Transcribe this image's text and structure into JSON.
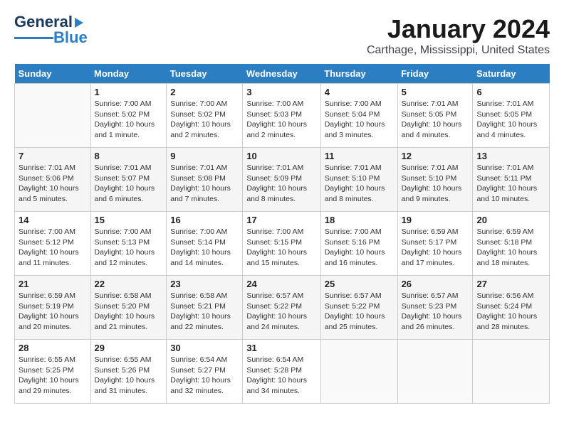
{
  "header": {
    "logo_line1": "General",
    "logo_line2": "Blue",
    "month": "January 2024",
    "location": "Carthage, Mississippi, United States"
  },
  "weekdays": [
    "Sunday",
    "Monday",
    "Tuesday",
    "Wednesday",
    "Thursday",
    "Friday",
    "Saturday"
  ],
  "weeks": [
    [
      {
        "day": "",
        "info": ""
      },
      {
        "day": "1",
        "info": "Sunrise: 7:00 AM\nSunset: 5:02 PM\nDaylight: 10 hours\nand 1 minute."
      },
      {
        "day": "2",
        "info": "Sunrise: 7:00 AM\nSunset: 5:02 PM\nDaylight: 10 hours\nand 2 minutes."
      },
      {
        "day": "3",
        "info": "Sunrise: 7:00 AM\nSunset: 5:03 PM\nDaylight: 10 hours\nand 2 minutes."
      },
      {
        "day": "4",
        "info": "Sunrise: 7:00 AM\nSunset: 5:04 PM\nDaylight: 10 hours\nand 3 minutes."
      },
      {
        "day": "5",
        "info": "Sunrise: 7:01 AM\nSunset: 5:05 PM\nDaylight: 10 hours\nand 4 minutes."
      },
      {
        "day": "6",
        "info": "Sunrise: 7:01 AM\nSunset: 5:05 PM\nDaylight: 10 hours\nand 4 minutes."
      }
    ],
    [
      {
        "day": "7",
        "info": "Sunrise: 7:01 AM\nSunset: 5:06 PM\nDaylight: 10 hours\nand 5 minutes."
      },
      {
        "day": "8",
        "info": "Sunrise: 7:01 AM\nSunset: 5:07 PM\nDaylight: 10 hours\nand 6 minutes."
      },
      {
        "day": "9",
        "info": "Sunrise: 7:01 AM\nSunset: 5:08 PM\nDaylight: 10 hours\nand 7 minutes."
      },
      {
        "day": "10",
        "info": "Sunrise: 7:01 AM\nSunset: 5:09 PM\nDaylight: 10 hours\nand 8 minutes."
      },
      {
        "day": "11",
        "info": "Sunrise: 7:01 AM\nSunset: 5:10 PM\nDaylight: 10 hours\nand 8 minutes."
      },
      {
        "day": "12",
        "info": "Sunrise: 7:01 AM\nSunset: 5:10 PM\nDaylight: 10 hours\nand 9 minutes."
      },
      {
        "day": "13",
        "info": "Sunrise: 7:01 AM\nSunset: 5:11 PM\nDaylight: 10 hours\nand 10 minutes."
      }
    ],
    [
      {
        "day": "14",
        "info": "Sunrise: 7:00 AM\nSunset: 5:12 PM\nDaylight: 10 hours\nand 11 minutes."
      },
      {
        "day": "15",
        "info": "Sunrise: 7:00 AM\nSunset: 5:13 PM\nDaylight: 10 hours\nand 12 minutes."
      },
      {
        "day": "16",
        "info": "Sunrise: 7:00 AM\nSunset: 5:14 PM\nDaylight: 10 hours\nand 14 minutes."
      },
      {
        "day": "17",
        "info": "Sunrise: 7:00 AM\nSunset: 5:15 PM\nDaylight: 10 hours\nand 15 minutes."
      },
      {
        "day": "18",
        "info": "Sunrise: 7:00 AM\nSunset: 5:16 PM\nDaylight: 10 hours\nand 16 minutes."
      },
      {
        "day": "19",
        "info": "Sunrise: 6:59 AM\nSunset: 5:17 PM\nDaylight: 10 hours\nand 17 minutes."
      },
      {
        "day": "20",
        "info": "Sunrise: 6:59 AM\nSunset: 5:18 PM\nDaylight: 10 hours\nand 18 minutes."
      }
    ],
    [
      {
        "day": "21",
        "info": "Sunrise: 6:59 AM\nSunset: 5:19 PM\nDaylight: 10 hours\nand 20 minutes."
      },
      {
        "day": "22",
        "info": "Sunrise: 6:58 AM\nSunset: 5:20 PM\nDaylight: 10 hours\nand 21 minutes."
      },
      {
        "day": "23",
        "info": "Sunrise: 6:58 AM\nSunset: 5:21 PM\nDaylight: 10 hours\nand 22 minutes."
      },
      {
        "day": "24",
        "info": "Sunrise: 6:57 AM\nSunset: 5:22 PM\nDaylight: 10 hours\nand 24 minutes."
      },
      {
        "day": "25",
        "info": "Sunrise: 6:57 AM\nSunset: 5:22 PM\nDaylight: 10 hours\nand 25 minutes."
      },
      {
        "day": "26",
        "info": "Sunrise: 6:57 AM\nSunset: 5:23 PM\nDaylight: 10 hours\nand 26 minutes."
      },
      {
        "day": "27",
        "info": "Sunrise: 6:56 AM\nSunset: 5:24 PM\nDaylight: 10 hours\nand 28 minutes."
      }
    ],
    [
      {
        "day": "28",
        "info": "Sunrise: 6:55 AM\nSunset: 5:25 PM\nDaylight: 10 hours\nand 29 minutes."
      },
      {
        "day": "29",
        "info": "Sunrise: 6:55 AM\nSunset: 5:26 PM\nDaylight: 10 hours\nand 31 minutes."
      },
      {
        "day": "30",
        "info": "Sunrise: 6:54 AM\nSunset: 5:27 PM\nDaylight: 10 hours\nand 32 minutes."
      },
      {
        "day": "31",
        "info": "Sunrise: 6:54 AM\nSunset: 5:28 PM\nDaylight: 10 hours\nand 34 minutes."
      },
      {
        "day": "",
        "info": ""
      },
      {
        "day": "",
        "info": ""
      },
      {
        "day": "",
        "info": ""
      }
    ]
  ]
}
